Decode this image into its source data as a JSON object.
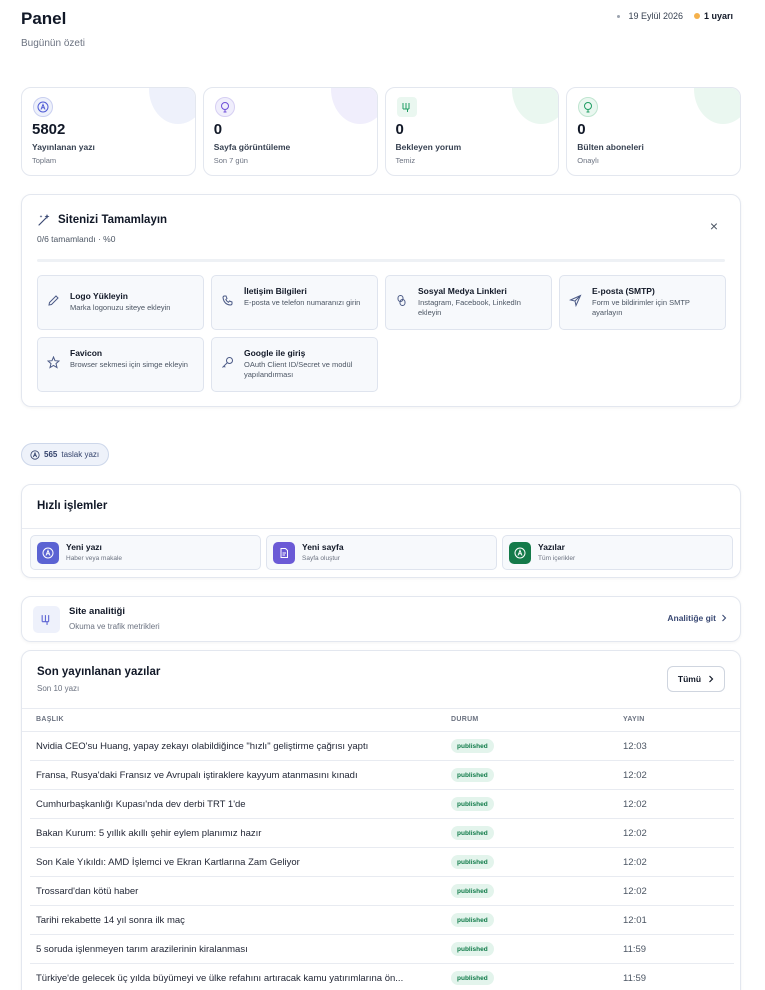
{
  "header": {
    "title": "Panel",
    "subtitle": "Bugünün özeti",
    "date": "19 Eylül 2026",
    "warnings": "1 uyarı"
  },
  "stats": [
    {
      "icon": "article-icon",
      "value": "5802",
      "label": "Yayınlanan yazı",
      "sub": "Toplam",
      "color": "#4f5bd5",
      "blob": "#eef1fb"
    },
    {
      "icon": "eye-icon",
      "value": "0",
      "label": "Sayfa görüntüleme",
      "sub": "Son 7 gün",
      "color": "#6f4fd8",
      "blob": "#f0eefc"
    },
    {
      "icon": "comments-icon",
      "value": "0",
      "label": "Bekleyen yorum",
      "sub": "Temiz",
      "color": "#1f9d63",
      "blob": "#eaf7f0"
    },
    {
      "icon": "subscribers-icon",
      "value": "0",
      "label": "Bülten aboneleri",
      "sub": "Onaylı",
      "color": "#1f9d63",
      "blob": "#eaf7f0"
    }
  ],
  "complete": {
    "title": "Sitenizi Tamamlayın",
    "progress": "0/6 tamamlandı · %0",
    "close": "×",
    "tasks": [
      {
        "icon": "pencil-icon",
        "title": "Logo Yükleyin",
        "desc": "Marka logonuzu siteye ekleyin",
        "two": false
      },
      {
        "icon": "phone-icon",
        "title": "İletişim Bilgileri",
        "desc": "E-posta ve telefon numaranızı girin",
        "two": true
      },
      {
        "icon": "link-icon",
        "title": "Sosyal Medya Linkleri",
        "desc": "Instagram, Facebook, LinkedIn ekleyin",
        "two": true
      },
      {
        "icon": "send-icon",
        "title": "E-posta (SMTP)",
        "desc": "Form ve bildirimler için SMTP ayarlayın",
        "two": true
      },
      {
        "icon": "star-icon",
        "title": "Favicon",
        "desc": "Browser sekmesi için simge ekleyin",
        "two": true
      },
      {
        "icon": "key-icon",
        "title": "Google ile giriş",
        "desc": "OAuth Client ID/Secret ve modül yapılandırması",
        "two": true
      }
    ]
  },
  "drafts": {
    "count": "565",
    "label": "taslak yazı"
  },
  "quick": {
    "title": "Hızlı işlemler",
    "actions": [
      {
        "icon": "new-post-icon",
        "label": "Yeni yazı",
        "sub": "Haber veya makale",
        "color": "#5b63d3"
      },
      {
        "icon": "new-page-icon",
        "label": "Yeni sayfa",
        "sub": "Sayfa oluştur",
        "color": "#6b5ad6"
      },
      {
        "icon": "posts-icon",
        "label": "Yazılar",
        "sub": "Tüm içerikler",
        "color": "#147a4a"
      }
    ]
  },
  "analytics": {
    "title": "Site analitiği",
    "sub": "Okuma ve trafik metrikleri",
    "link": "Analitiğe git"
  },
  "recent": {
    "title": "Son yayınlanan yazılar",
    "sub": "Son 10 yazı",
    "all": "Tümü",
    "columns": {
      "title": "BAŞLIK",
      "status": "DURUM",
      "published": "YAYIN"
    },
    "rows": [
      {
        "title": "Nvidia CEO'su Huang, yapay zekayı olabildiğince \"hızlı\" geliştirme çağrısı yaptı",
        "status": "published",
        "time": "12:03"
      },
      {
        "title": "Fransa, Rusya'daki Fransız ve Avrupalı iştiraklere kayyum atanmasını kınadı",
        "status": "published",
        "time": "12:02"
      },
      {
        "title": "Cumhurbaşkanlığı Kupası'nda dev derbi TRT 1'de",
        "status": "published",
        "time": "12:02"
      },
      {
        "title": "Bakan Kurum: 5 yıllık akıllı şehir eylem planımız hazır",
        "status": "published",
        "time": "12:02"
      },
      {
        "title": "Son Kale Yıkıldı: AMD İşlemci ve Ekran Kartlarına Zam Geliyor",
        "status": "published",
        "time": "12:02"
      },
      {
        "title": "Trossard'dan kötü haber",
        "status": "published",
        "time": "12:02"
      },
      {
        "title": "Tarihi rekabette 14 yıl sonra ilk maç",
        "status": "published",
        "time": "12:01"
      },
      {
        "title": "5 soruda işlenmeyen tarım arazilerinin kiralanması",
        "status": "published",
        "time": "11:59"
      },
      {
        "title": "Türkiye'de gelecek üç yılda büyümeyi ve ülke refahını artıracak kamu yatırımlarına ön...",
        "status": "published",
        "time": "11:59"
      }
    ]
  }
}
